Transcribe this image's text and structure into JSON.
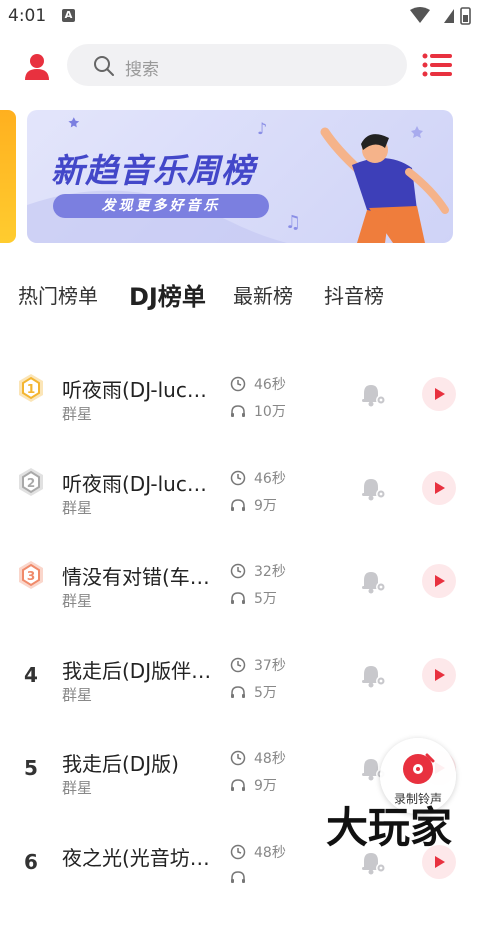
{
  "status_bar": {
    "time": "4:01",
    "notif_letter": "A"
  },
  "header": {
    "search_placeholder": "搜索"
  },
  "banner": {
    "title": "新趋音乐周榜",
    "subtitle": "发现更多好音乐"
  },
  "tabs": [
    {
      "label": "热门榜单",
      "active": false
    },
    {
      "label": "DJ榜单",
      "active": true
    },
    {
      "label": "最新榜",
      "active": false
    },
    {
      "label": "抖音榜",
      "active": false
    }
  ],
  "songs": [
    {
      "rank": "1",
      "title": "听夜雨(DJ-luc…",
      "artist": "群星",
      "duration": "46秒",
      "plays": "10万"
    },
    {
      "rank": "2",
      "title": "听夜雨(DJ-luc…",
      "artist": "群星",
      "duration": "46秒",
      "plays": "9万"
    },
    {
      "rank": "3",
      "title": "情没有对错(车…",
      "artist": "群星",
      "duration": "32秒",
      "plays": "5万"
    },
    {
      "rank": "4",
      "title": "我走后(DJ版伴…",
      "artist": "群星",
      "duration": "37秒",
      "plays": "5万"
    },
    {
      "rank": "5",
      "title": "我走后(DJ版)",
      "artist": "群星",
      "duration": "48秒",
      "plays": "9万"
    },
    {
      "rank": "6",
      "title": "夜之光(光音坊…",
      "artist": "",
      "duration": "48秒",
      "plays": ""
    }
  ],
  "record_button": {
    "label": "录制铃声"
  },
  "watermark": "大玩家",
  "colors": {
    "accent": "#e8313f",
    "banner_text": "#4347c9",
    "medal_gold": "#f3b530",
    "medal_silver": "#a9a9a9",
    "medal_bronze": "#f08a6a"
  }
}
